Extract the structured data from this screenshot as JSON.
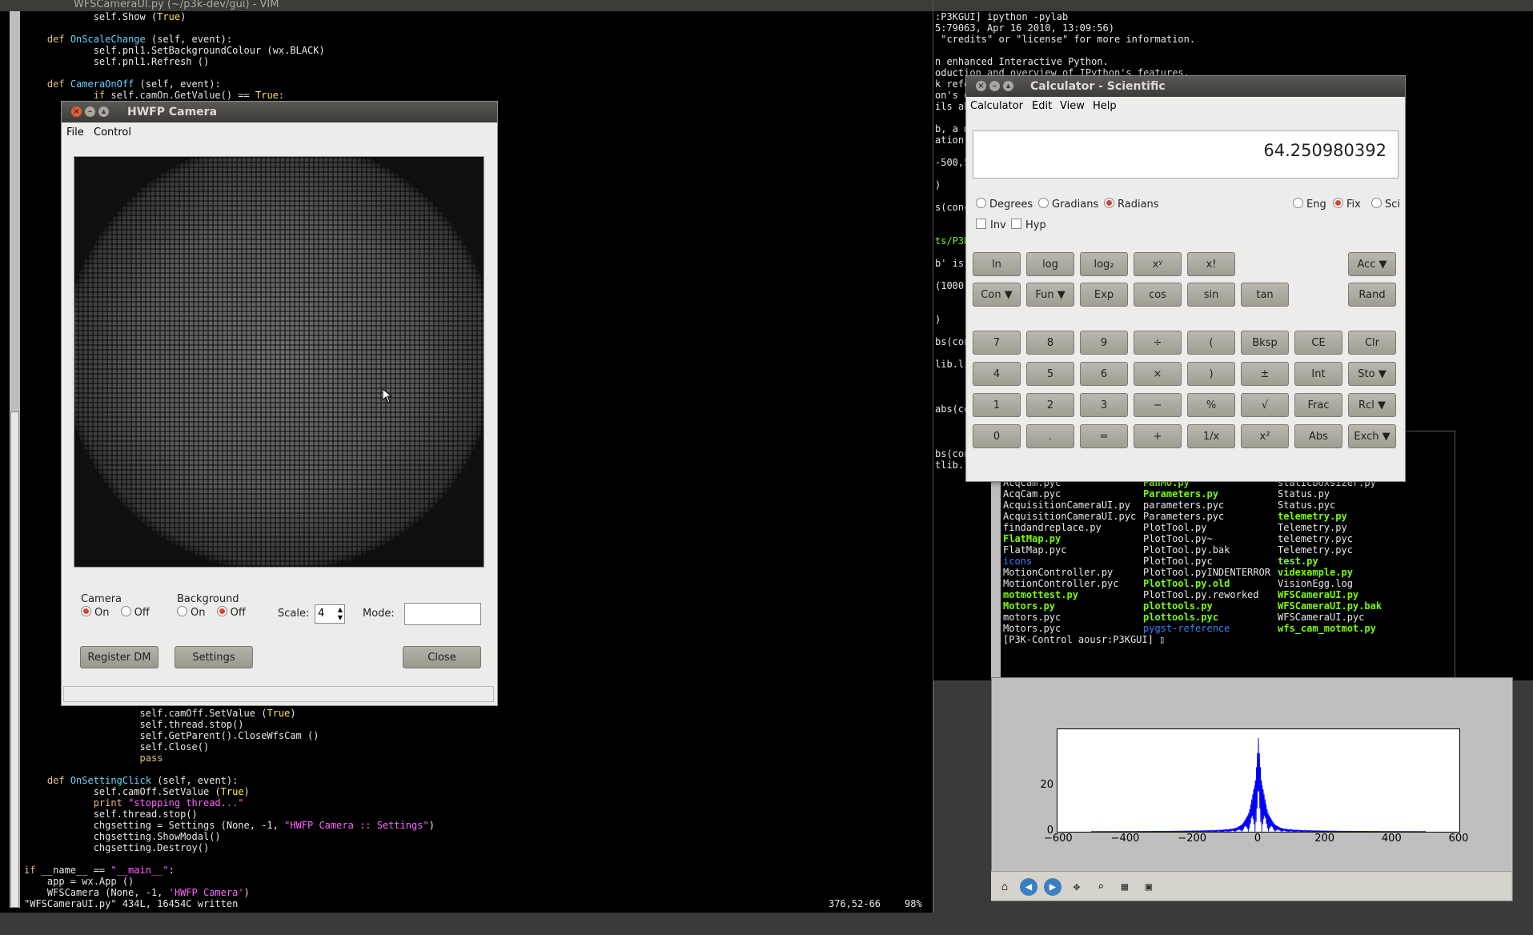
{
  "vim": {
    "title": "WFSCameraUI.py (~/p3k-dev/gui) - VIM",
    "code_top": [
      {
        "t": "            self.Show (",
        "k": "True",
        ")": ")"
      }
    ],
    "lines": [
      "            self.Show (True)",
      "",
      "    def OnScaleChange (self, event):",
      "            self.pnl1.SetBackgroundColour (wx.BLACK)",
      "            self.pnl1.Refresh ()",
      "",
      "    def CameraOnOff (self, event):",
      "            if self.camOn.GetValue() == True:"
    ],
    "lines_bottom": [
      "                    self.camOff.SetValue (True)",
      "                    self.thread.stop()",
      "                    self.GetParent().CloseWfsCam ()",
      "                    self.Close()",
      "                    pass",
      "",
      "    def OnSettingClick (self, event):",
      "            self.camOff.SetValue (True)",
      "            print \"stopping thread...\"",
      "            self.thread.stop()",
      "            chgsetting = Settings (None, -1, \"HWFP Camera :: Settings\")",
      "            chgsetting.ShowModal()",
      "            chgsetting.Destroy()",
      "",
      "if __name__ == \"__main__\":",
      "    app = wx.App ()",
      "    WFSCamera (None, -1, 'HWFP Camera')"
    ],
    "status_left": "\"WFSCameraUI.py\" 434L, 16454C written",
    "status_pos": "376,52-66",
    "status_pct": "98%"
  },
  "camera": {
    "title": "HWFP Camera",
    "menu": [
      "File",
      "Control"
    ],
    "camera_label": "Camera",
    "camera_on": "On",
    "camera_off": "Off",
    "background_label": "Background",
    "background_on": "On",
    "background_off": "Off",
    "scale_label": "Scale:",
    "scale_value": "4",
    "mode_label": "Mode:",
    "mode_value": "",
    "register_btn": "Register DM",
    "settings_btn": "Settings",
    "close_btn": "Close"
  },
  "ipython": {
    "lines": [
      ":P3KGUI] ipython -pylab",
      "5:79063, Apr 16 2010, 13:09:56)",
      " \"credits\" or \"license\" for more information.",
      "",
      "n enhanced Interactive Python.",
      "oduction and overview of IPython's features.",
      "k refe",
      "on's o",
      "ils ab",
      "",
      "b, a m",
      "ation,",
      "",
      "-500,5",
      "",
      ")",
      "",
      "s(conc",
      "",
      "",
      "ts/P3K",
      "",
      "b' is",
      "",
      "(1000)",
      "",
      "",
      ")",
      "",
      "bs(con",
      "",
      "lib.li",
      "",
      "",
      "",
      "abs(co",
      "",
      "",
      "",
      "bs(concate",
      "tlib.lines"
    ]
  },
  "calculator": {
    "title": "Calculator - Scientific",
    "menu": [
      "Calculator",
      "Edit",
      "View",
      "Help"
    ],
    "display": "64.250980392",
    "angle_opts": [
      "Degrees",
      "Gradians",
      "Radians"
    ],
    "fmt_opts": [
      "Eng",
      "Fix",
      "Sci"
    ],
    "inv": "Inv",
    "hyp": "Hyp",
    "row1": [
      "ln",
      "log",
      "log₂",
      "xʸ",
      "x!"
    ],
    "row2": [
      "Con ▼",
      "Fun ▼",
      "Exp",
      "cos",
      "sin",
      "tan"
    ],
    "acc": "Acc ▼",
    "rand": "Rand",
    "keypad": [
      [
        "7",
        "8",
        "9",
        "÷",
        "(",
        "Bksp",
        "CE",
        "Clr"
      ],
      [
        "4",
        "5",
        "6",
        "×",
        ")",
        "±",
        "Int",
        "Sto ▼"
      ],
      [
        "1",
        "2",
        "3",
        "−",
        "%",
        "√",
        "Frac",
        "Rcl ▼"
      ],
      [
        "0",
        ".",
        "=",
        "+",
        "1/x",
        "x²",
        "Abs",
        "Exch ▼"
      ]
    ]
  },
  "files": {
    "col1": [
      {
        "n": "AcqCam.pyc",
        "c": "fl"
      },
      {
        "n": "AcqCam.pyc",
        "c": "fl"
      },
      {
        "n": "AcquisitionCameraUI.py",
        "c": "fl"
      },
      {
        "n": "AcquisitionCameraUI.pyc",
        "c": "fl"
      },
      {
        "n": "findandreplace.py",
        "c": "fl"
      },
      {
        "n": "FlatMap.py",
        "c": "fg"
      },
      {
        "n": "FlatMap.pyc",
        "c": "fl"
      },
      {
        "n": "icons",
        "c": "fb"
      },
      {
        "n": "MotionController.py",
        "c": "fl"
      },
      {
        "n": "MotionController.pyc",
        "c": "fl"
      },
      {
        "n": "motmottest.py",
        "c": "fg"
      },
      {
        "n": "Motors.py",
        "c": "fg"
      },
      {
        "n": "motors.pyc",
        "c": "fl"
      },
      {
        "n": "Motors.pyc",
        "c": "fl"
      }
    ],
    "col2": [
      {
        "n": "PanMo.py",
        "c": "fg"
      },
      {
        "n": "Parameters.py",
        "c": "fg"
      },
      {
        "n": "parameters.pyc",
        "c": "fl"
      },
      {
        "n": "Parameters.pyc",
        "c": "fl"
      },
      {
        "n": "PlotTool.py",
        "c": "fl"
      },
      {
        "n": "PlotTool.py~",
        "c": "fl"
      },
      {
        "n": "PlotTool.py.bak",
        "c": "fl"
      },
      {
        "n": "PlotTool.pyc",
        "c": "fl"
      },
      {
        "n": "PlotTool.pyINDENTERROR",
        "c": "fl"
      },
      {
        "n": "PlotTool.py.old",
        "c": "fg"
      },
      {
        "n": "PlotTool.py.reworked",
        "c": "fl"
      },
      {
        "n": "plottools.py",
        "c": "fg"
      },
      {
        "n": "plottools.pyc",
        "c": "fg"
      },
      {
        "n": "pygst-reference",
        "c": "fb"
      }
    ],
    "col3": [
      {
        "n": "staticboxsizer.py",
        "c": "fl"
      },
      {
        "n": "Status.py",
        "c": "fl"
      },
      {
        "n": "Status.pyc",
        "c": "fl"
      },
      {
        "n": "telemetry.py",
        "c": "fg"
      },
      {
        "n": "Telemetry.py",
        "c": "fl"
      },
      {
        "n": "telemetry.pyc",
        "c": "fl"
      },
      {
        "n": "Telemetry.pyc",
        "c": "fl"
      },
      {
        "n": "test.py",
        "c": "fg"
      },
      {
        "n": "videxample.py",
        "c": "fg"
      },
      {
        "n": "VisionEgg.log",
        "c": "fl"
      },
      {
        "n": "WFSCameraUI.py",
        "c": "fg"
      },
      {
        "n": "WFSCameraUI.py.bak",
        "c": "fg"
      },
      {
        "n": "WFSCameraUI.pyc",
        "c": "fl"
      },
      {
        "n": "wfs_cam_motmot.py",
        "c": "fg"
      }
    ],
    "prompt": "[P3K-Control aousr:P3KGUI] ▯"
  },
  "chart_data": {
    "type": "line",
    "xticks": [
      "−600",
      "−400",
      "−200",
      "0",
      "200",
      "400",
      "600"
    ],
    "yticks": [
      "0",
      "20"
    ],
    "xlim": [
      -600,
      600
    ],
    "ylim": [
      0,
      45
    ],
    "series": [
      {
        "color": "#0000ff"
      }
    ]
  },
  "plot_toolbar": [
    "home-icon",
    "back-icon",
    "forward-icon",
    "pan-icon",
    "zoom-icon",
    "subplots-icon",
    "save-icon"
  ]
}
